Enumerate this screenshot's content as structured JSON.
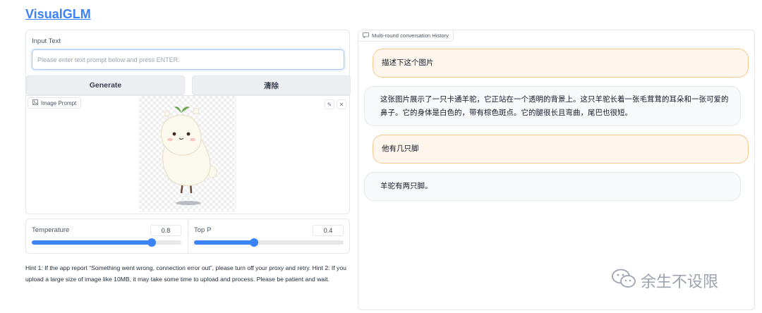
{
  "app": {
    "title": "VisualGLM"
  },
  "input": {
    "label": "Input Text",
    "placeholder": "Please enter text prompt below and press ENTER."
  },
  "buttons": {
    "generate": "Generate",
    "clear": "清除"
  },
  "image_prompt": {
    "label": "Image Prompt",
    "edit_icon": "pencil-icon",
    "close_icon": "close-icon"
  },
  "sliders": {
    "temperature": {
      "label": "Temperature",
      "value": "0.8",
      "fraction": 0.8
    },
    "top_p": {
      "label": "Top P",
      "value": "0.4",
      "fraction": 0.4
    }
  },
  "hint": "Hint 1: If the app report “Something went wrong, connection error out”, please turn off your proxy and retry. Hint 2: If you upload a large size of image like 10MB, it may take some time to upload and process. Please be patient and wait.",
  "chat": {
    "label": "Multi-round conversation History",
    "messages": [
      {
        "role": "user",
        "text": "描述下这个图片"
      },
      {
        "role": "bot",
        "text": "这张图片展示了一只卡通羊驼，它正站在一个透明的背景上。这只羊驼长着一张毛茸茸的耳朵和一张可爱的鼻子。它的身体是白色的，带有棕色斑点。它的腿很长且弯曲，尾巴也很短。"
      },
      {
        "role": "user",
        "text": "他有几只脚"
      },
      {
        "role": "bot",
        "text": "羊驼有两只脚。"
      }
    ]
  },
  "watermark": {
    "text": "余生不设限",
    "icon": "wechat-icon"
  },
  "colors": {
    "accent": "#3b82f6",
    "user_bubble": "#fef6ec",
    "user_border": "#f4c98e",
    "bot_bubble": "#f8f9fb"
  }
}
